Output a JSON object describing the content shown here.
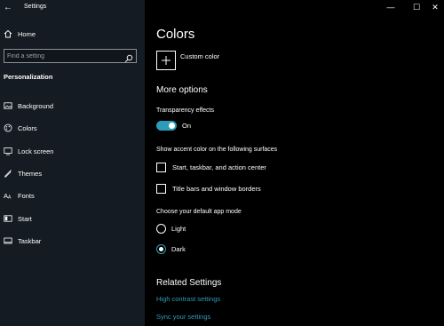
{
  "window": {
    "title": "Settings",
    "back_glyph": "←",
    "minimize_glyph": "—",
    "maximize_glyph": "☐",
    "close_glyph": "✕"
  },
  "sidebar": {
    "home_label": "Home",
    "search_placeholder": "Find a setting",
    "section_title": "Personalization",
    "items": [
      {
        "label": "Background",
        "icon": "image-icon"
      },
      {
        "label": "Colors",
        "icon": "palette-icon"
      },
      {
        "label": "Lock screen",
        "icon": "lock-screen-icon"
      },
      {
        "label": "Themes",
        "icon": "themes-icon"
      },
      {
        "label": "Fonts",
        "icon": "fonts-icon"
      },
      {
        "label": "Start",
        "icon": "start-icon"
      },
      {
        "label": "Taskbar",
        "icon": "taskbar-icon"
      }
    ]
  },
  "main": {
    "title": "Colors",
    "custom_color_label": "Custom color",
    "more_options_heading": "More options",
    "transparency_label": "Transparency effects",
    "transparency_state": "On",
    "accent_surfaces_label": "Show accent color on the following surfaces",
    "checkbox_start": "Start, taskbar, and action center",
    "checkbox_titlebars": "Title bars and window borders",
    "app_mode_label": "Choose your default app mode",
    "mode_light": "Light",
    "mode_dark": "Dark",
    "selected_mode": "Dark",
    "related_heading": "Related Settings",
    "link_high_contrast": "High contrast settings",
    "link_sync": "Sync your settings"
  },
  "colors": {
    "accent": "#2d9cb8",
    "sidebar_bg": "#141b22",
    "main_bg": "#000000"
  }
}
